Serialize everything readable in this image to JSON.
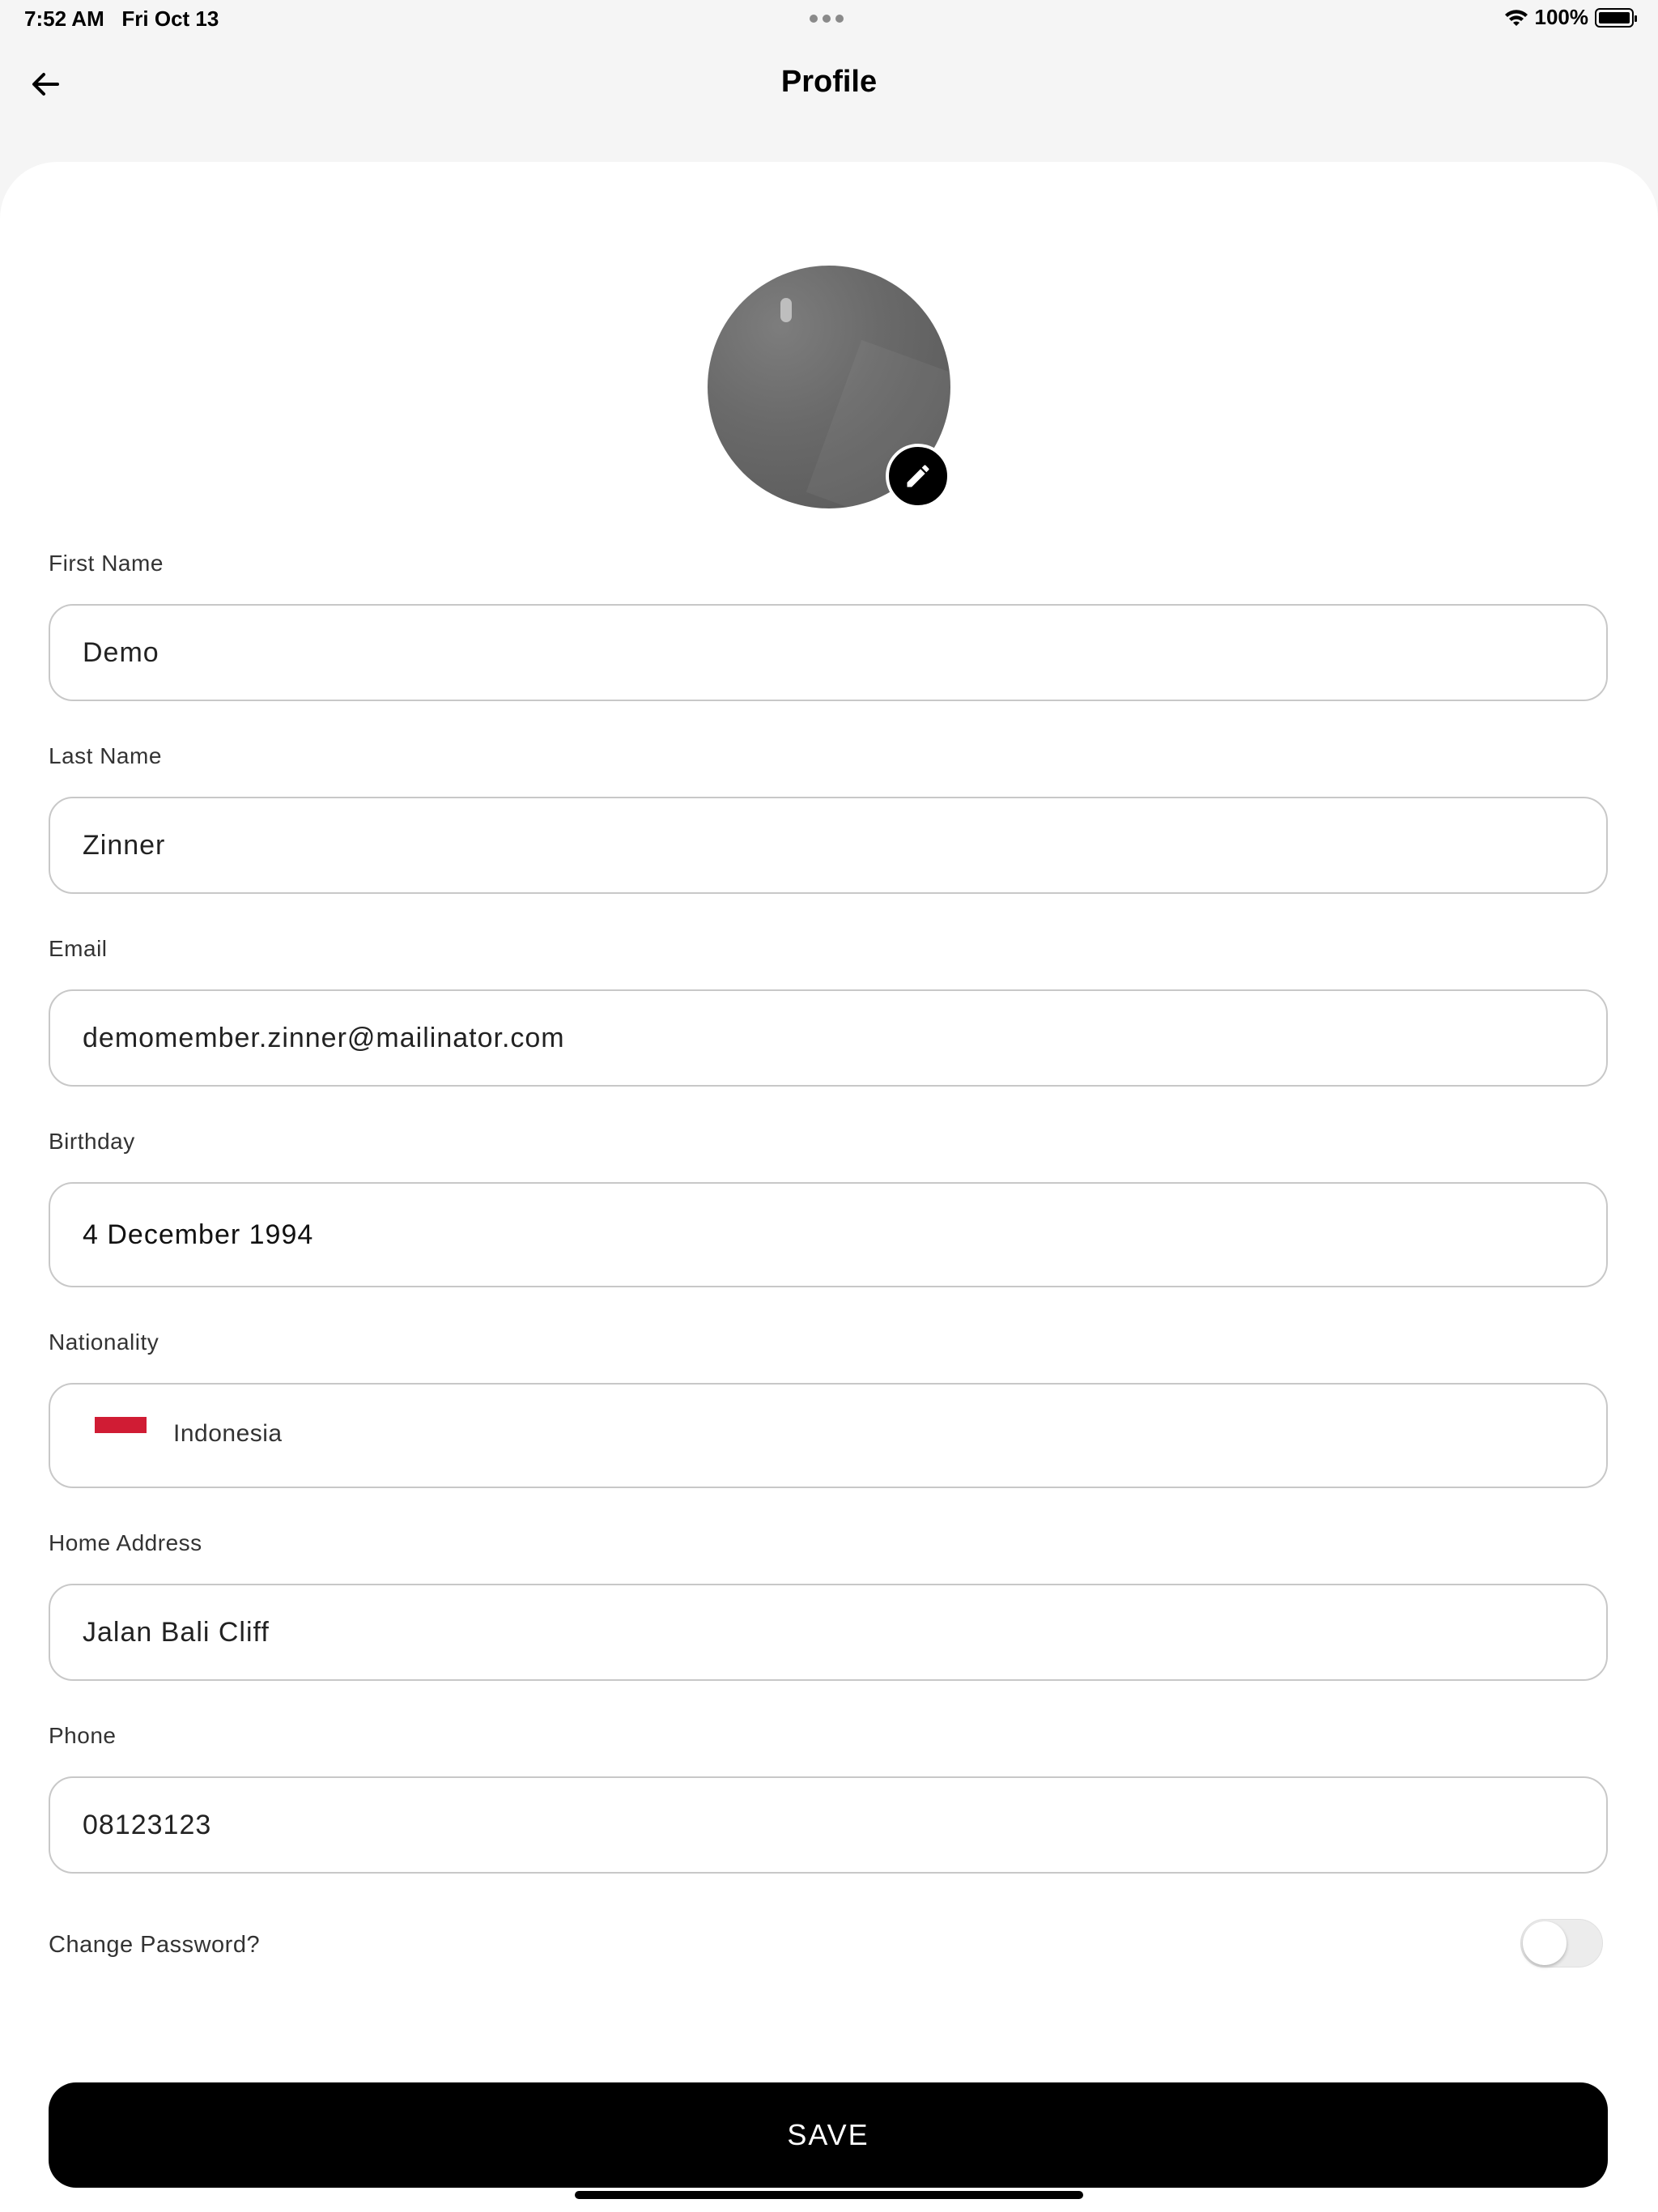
{
  "status_bar": {
    "time": "7:52 AM",
    "date": "Fri Oct 13",
    "battery": "100%"
  },
  "header": {
    "title": "Profile",
    "back_icon": "arrow-left-icon"
  },
  "avatar": {
    "edit_icon": "pencil-icon"
  },
  "form": {
    "first_name": {
      "label": "First Name",
      "value": "Demo"
    },
    "last_name": {
      "label": "Last Name",
      "value": "Zinner"
    },
    "email": {
      "label": "Email",
      "value": "demomember.zinner@mailinator.com"
    },
    "birthday": {
      "label": "Birthday",
      "value": "4 December 1994"
    },
    "nationality": {
      "label": "Nationality",
      "value": "Indonesia",
      "flag_colors": [
        "#d01c34",
        "#ffffff"
      ]
    },
    "home_address": {
      "label": "Home Address",
      "value": "Jalan Bali Cliff"
    },
    "phone": {
      "label": "Phone",
      "value": "08123123"
    },
    "change_password": {
      "label": "Change Password?",
      "enabled": false
    }
  },
  "actions": {
    "save_label": "SAVE"
  },
  "colors": {
    "background": "#f5f5f5",
    "card": "#ffffff",
    "primary": "#000000",
    "border": "#c8c8c8"
  }
}
